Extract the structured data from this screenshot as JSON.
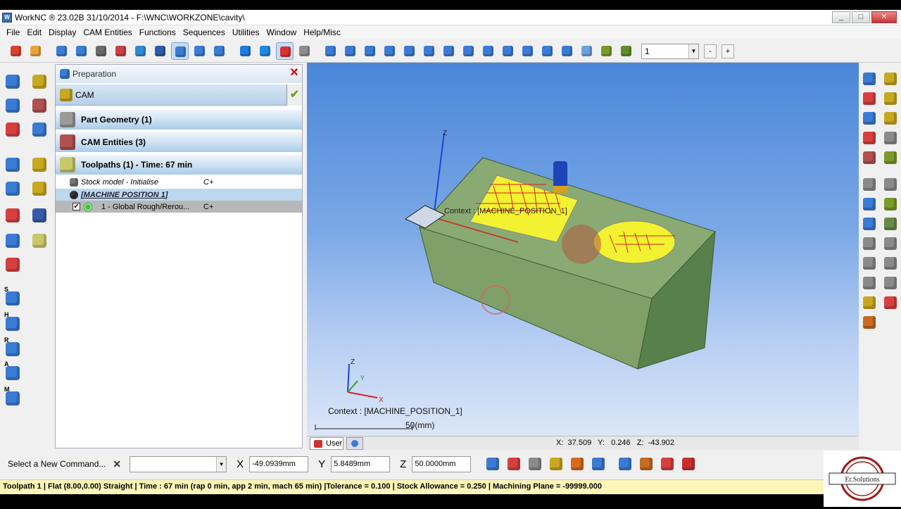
{
  "window": {
    "title": "WorkNC ® 23.02B     31/10/2014  -  F:\\WNC\\WORKZONE\\cavity\\",
    "minimize": "_",
    "maximize": "□",
    "close": "✕"
  },
  "menu": [
    "File",
    "Edit",
    "Display",
    "CAM Entities",
    "Functions",
    "Sequences",
    "Utilities",
    "Window",
    "Help/Misc"
  ],
  "toolbar": {
    "view_combo_value": "1",
    "minus": "-",
    "plus": "+",
    "colors": [
      "#d9412e",
      "#e8a33c",
      "#3a7bd5",
      "#3a7bd5",
      "#6a6a6a",
      "#c94040",
      "#2e8bd6",
      "#2e5aa8",
      "#3a7bd5",
      "#3a7bd5",
      "#3a7bd5",
      "#1f7be0",
      "#1e88e5",
      "#d93030",
      "#8c8c8c",
      "#3a7bd5",
      "#3a7bd5",
      "#3a7bd5",
      "#3a7bd5",
      "#3a7bd5",
      "#3a7bd5",
      "#3a7bd5",
      "#3a7bd5",
      "#3a7bd5",
      "#3a7bd5",
      "#3a7bd5",
      "#3a7bd5",
      "#3a7bd5",
      "#6aa2dd",
      "#7a9a2a",
      "#5d8e2a"
    ]
  },
  "panel": {
    "header": "Preparation",
    "cam_label": "CAM",
    "sections": [
      {
        "label": "Part Geometry (1)",
        "icon": "part-geometry-icon",
        "color": "#9a9a9a"
      },
      {
        "label": "CAM Entities (3)",
        "icon": "cam-entities-icon",
        "color": "#b05050"
      },
      {
        "label": "Toolpaths (1) - Time: 67 min",
        "icon": "toolpaths-icon",
        "color": "#c8c86a"
      }
    ],
    "tree": {
      "stock": {
        "label": "Stock model - Initialise",
        "suffix": "C+"
      },
      "machine": {
        "label": "[MACHINE POSITION  1]"
      },
      "toolpath": {
        "label": "1 - Global Rough/Rerou...",
        "suffix": "C+",
        "checked": "✔"
      }
    }
  },
  "viewport": {
    "context_label_3d": "Context : [MACHINE_POSITION_1]",
    "context_label": "Context : [MACHINE_POSITION_1]",
    "scale_label": "50(mm)",
    "axis_z": "Z",
    "axis_y": "Y",
    "axis_x": "X",
    "user_tab": "User",
    "coords": "X:  37.509   Y:   0.246   Z:  -43.902"
  },
  "command_bar": {
    "prompt": "Select a New Command...",
    "cancel": "✕",
    "x_label": "X",
    "x_value": "-49.0939mm",
    "y_label": "Y",
    "y_value": "5.8489mm",
    "z_label": "Z",
    "z_value": "50.0000mm"
  },
  "status_line": "Toolpath 1 | Flat (8.00,0.00) Straight | Time : 67 min (rap 0 min, app 2 min, mach 65 min) |Tolerance = 0.100 | Stock Allowance = 0.250 | Machining Plane = -99999.000",
  "logo_text": "Er.Solutions",
  "left_tool_letters": [
    "S",
    "H",
    "R",
    "A",
    "M"
  ]
}
